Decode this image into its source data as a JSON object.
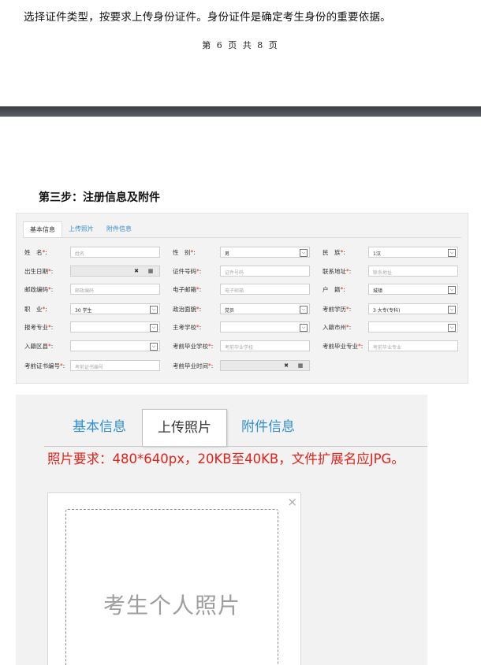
{
  "page1": {
    "text": "选择证件类型，按要求上传身份证件。身份证件是确定考生身份的重要依据。",
    "footer": "第 6 页 共 8 页"
  },
  "step3_heading": "第三步：注册信息及附件",
  "form": {
    "tabs": [
      "基本信息",
      "上传照片",
      "附件信息"
    ],
    "rows": [
      [
        {
          "label": "姓　名",
          "placeholder": "姓名",
          "type": "text"
        },
        {
          "label": "性　别",
          "value": "男",
          "type": "select"
        },
        {
          "label": "民　族",
          "value": "1汉",
          "type": "select"
        }
      ],
      [
        {
          "label": "出生日期",
          "type": "date"
        },
        {
          "label": "证件号码",
          "placeholder": "证件号码",
          "type": "text"
        },
        {
          "label": "联系地址",
          "placeholder": "联系地址",
          "type": "text"
        }
      ],
      [
        {
          "label": "邮政编码",
          "placeholder": "邮政编码",
          "type": "text"
        },
        {
          "label": "电子邮箱",
          "placeholder": "电子邮箱",
          "type": "text"
        },
        {
          "label": "户　籍",
          "value": "城镇",
          "type": "select"
        }
      ],
      [
        {
          "label": "职　业",
          "value": "30 学生",
          "type": "select"
        },
        {
          "label": "政治面貌",
          "value": "党员",
          "type": "select"
        },
        {
          "label": "考前学历",
          "value": "3 大专(专科)",
          "type": "select"
        }
      ],
      [
        {
          "label": "报考专业",
          "type": "select"
        },
        {
          "label": "主考学校",
          "type": "select"
        },
        {
          "label": "入籍市州",
          "type": "select"
        }
      ],
      [
        {
          "label": "入籍区县",
          "type": "select"
        },
        {
          "label": "考前毕业学校",
          "placeholder": "考前毕业学校",
          "type": "text"
        },
        {
          "label": "考前毕业专业",
          "placeholder": "考前毕业专业",
          "type": "text"
        }
      ],
      [
        {
          "label": "考前证书编号",
          "placeholder": "考前证书编号",
          "type": "text"
        },
        {
          "label": "考前毕业时间",
          "type": "date"
        }
      ]
    ],
    "required_mark": "*",
    "colon": ":",
    "date_clear_glyph": "✖",
    "date_cal_glyph": "▦",
    "select_arrow_glyph": "⌵"
  },
  "photo": {
    "tabs": {
      "basic": "基本信息",
      "upload": "上传照片",
      "attach": "附件信息"
    },
    "requirement": "照片要求：480*640px，20KB至40KB，文件扩展名应JPG。",
    "close_glyph": "×",
    "placeholder": "考生个人照片"
  },
  "colors": {
    "accent": "#2f8ed8",
    "required": "#e0231b"
  }
}
